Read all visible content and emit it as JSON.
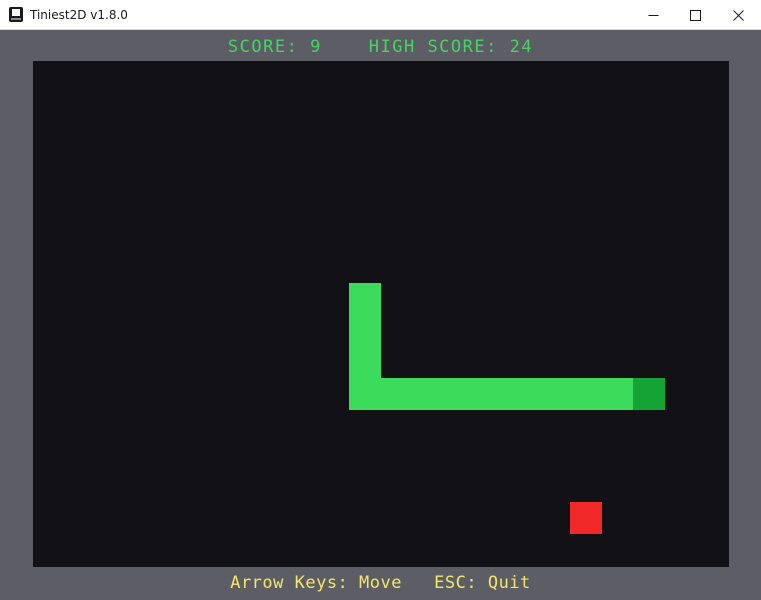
{
  "window": {
    "title": "Tiniest2D v1.8.0",
    "icon": "app-logo-icon",
    "controls": [
      "minimize-icon",
      "maximize-icon",
      "close-icon"
    ]
  },
  "hud": {
    "score_label": "SCORE:",
    "score": "9",
    "high_score_label": "HIGH SCORE:",
    "high_score": "24",
    "color": "#43d662"
  },
  "game": {
    "arena_color": "#121116",
    "snake_body_color": "#3cdb5c",
    "snake_head_color": "#16a335",
    "food_color": "#f02828",
    "grid_cell": 32,
    "snake": [
      {
        "col": 10,
        "row": 7
      },
      {
        "col": 10,
        "row": 8
      },
      {
        "col": 10,
        "row": 10
      },
      {
        "col": 11,
        "row": 10
      },
      {
        "col": 12,
        "row": 10
      },
      {
        "col": 13,
        "row": 10
      },
      {
        "col": 14,
        "row": 10
      },
      {
        "col": 15,
        "row": 10
      },
      {
        "col": 16,
        "row": 10
      },
      {
        "col": 17,
        "row": 10
      },
      {
        "col": 18,
        "row": 10
      },
      {
        "col": 19,
        "row": 10
      }
    ],
    "food": {
      "col": 17,
      "row": 14
    }
  },
  "footer": {
    "text": "Arrow Keys: Move   ESC: Quit",
    "color": "#f3e76a"
  }
}
